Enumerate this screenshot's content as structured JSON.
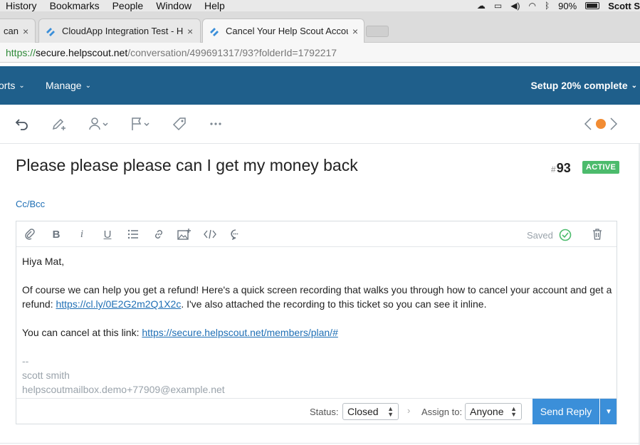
{
  "menubar": {
    "items": [
      "History",
      "Bookmarks",
      "People",
      "Window",
      "Help"
    ],
    "battery": "90%",
    "user": "Scott S"
  },
  "tabs": [
    {
      "title": "can",
      "close": "×"
    },
    {
      "title": "CloudApp Integration Test - He",
      "close": "×"
    },
    {
      "title": "Cancel Your Help Scout Accou",
      "close": "×"
    }
  ],
  "address": {
    "scheme": "https://",
    "host": "secure.helpscout.net",
    "path": "/conversation/499691317/93?folderId=1792217"
  },
  "appnav": {
    "items": [
      {
        "label": "orts"
      },
      {
        "label": "Manage"
      }
    ],
    "setup": "Setup 20% complete",
    "accent": "#1f5f8b"
  },
  "toolbar": {
    "icons": [
      "undo-icon",
      "edit-note-icon",
      "assign-user-icon",
      "flag-icon",
      "tag-icon",
      "more-icon"
    ]
  },
  "conversation": {
    "subject": "Please please please can I get my money back",
    "number_hash": "#",
    "number": "93",
    "status": "ACTIVE",
    "status_color": "#4cbb6c",
    "ccbcc": "Cc/Bcc"
  },
  "editor": {
    "saved_label": "Saved",
    "greeting": "Hiya Mat,",
    "p1_before": "Of course we can help you get a refund! Here's a quick screen recording that walks you through how to cancel your account and get a refund: ",
    "p1_link": "https://cl.ly/0E2G2m2Q1X2c",
    "p1_after": ". I've also attached the recording to this ticket so you can see it inline.",
    "p2_before": "You can cancel at this link: ",
    "p2_link": "https://secure.helpscout.net/members/plan/#",
    "sig_dash": "--",
    "sig_name": "scott smith",
    "sig_email": "helpscoutmailbox.demo+77909@example.net"
  },
  "footer": {
    "status_label": "Status:",
    "status_value": "Closed",
    "assign_label": "Assign to:",
    "assign_value": "Anyone",
    "send_label": "Send Reply",
    "send_color": "#3b8fd9"
  }
}
